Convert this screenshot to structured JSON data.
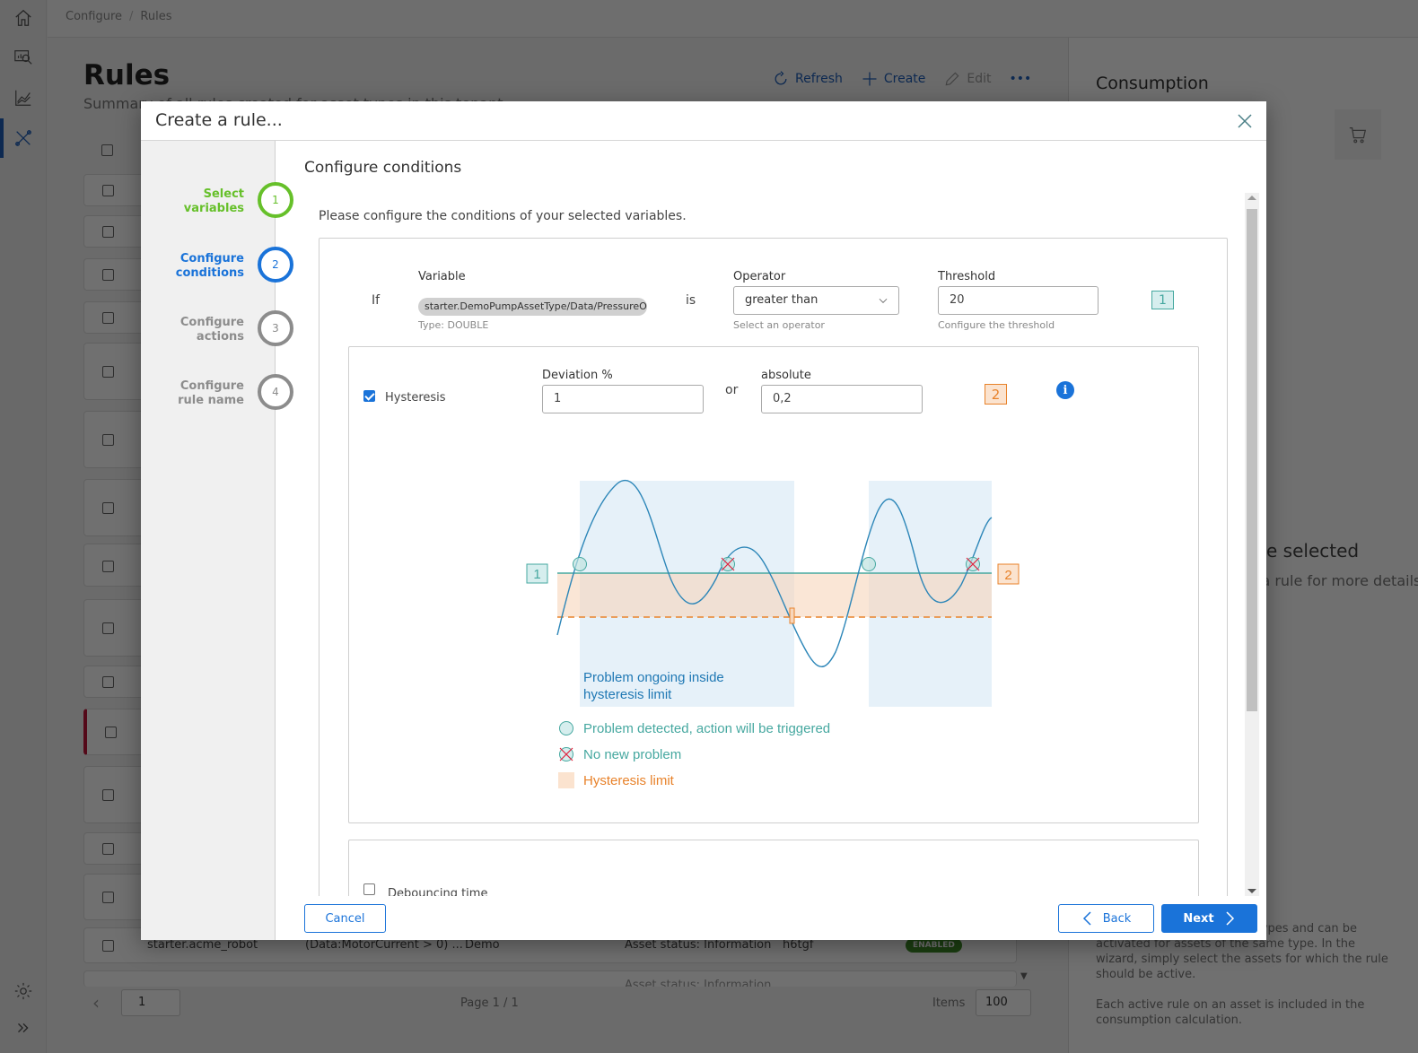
{
  "app": {
    "breadcrumb": [
      "Configure",
      "Rules"
    ],
    "page_title": "Rules",
    "page_subtitle": "Summary of all rules created for asset types in this tenant",
    "toolbar": {
      "refresh_label": "Refresh",
      "create_label": "Create",
      "edit_label": "Edit",
      "more_label": "•••"
    },
    "sidebar_icons": [
      "home-icon",
      "monitor-search-icon",
      "analytics-chart-icon",
      "tools-icon",
      "settings-gear-icon",
      "expand-icon"
    ],
    "consumption": {
      "title": "Consumption",
      "empty_title": "No rule selected",
      "empty_subtitle": "Select a rule for more details",
      "info_paragraph_1": "Rules are created for asset types and can be activated for assets of the same type. In the wizard, simply select the assets for which the rule should be active.",
      "info_paragraph_2": "Each active rule on an asset is included in the consumption calculation."
    },
    "visible_row": {
      "name": "starter.acme_robot",
      "condition": "(Data:MotorCurrent > 0) ...",
      "tenant": "Demo",
      "action": "Asset status: Information",
      "author": "h6tgf",
      "status": "ENABLED"
    },
    "partial_row_text": "Asset status: Information",
    "pager": {
      "page_value": "1",
      "page_info": "Page 1 / 1",
      "items_label": "Items",
      "items_value": "100"
    }
  },
  "modal": {
    "title": "Create a rule...",
    "steps": [
      {
        "number": "1",
        "label_line1": "Select",
        "label_line2": "variables",
        "state": "done"
      },
      {
        "number": "2",
        "label_line1": "Configure",
        "label_line2": "conditions",
        "state": "active"
      },
      {
        "number": "3",
        "label_line1": "Configure",
        "label_line2": "actions",
        "state": "todo"
      },
      {
        "number": "4",
        "label_line1": "Configure",
        "label_line2": "rule name",
        "state": "todo"
      }
    ],
    "section_title": "Configure conditions",
    "intro": "Please configure the conditions of your selected variables.",
    "condition": {
      "if_label": "If",
      "is_label": "is",
      "variable_label": "Variable",
      "variable_value": "starter.DemoPumpAssetType/Data/PressureOut",
      "variable_type": "Type: DOUBLE",
      "operator_label": "Operator",
      "operator_value": "greater than",
      "operator_hint": "Select an operator",
      "threshold_label": "Threshold",
      "threshold_value": "20",
      "threshold_hint": "Configure the threshold",
      "marker": "1"
    },
    "hysteresis": {
      "checked": true,
      "label": "Hysteresis",
      "deviation_label": "Deviation %",
      "deviation_value": "1",
      "or_label": "or",
      "absolute_label": "absolute",
      "absolute_value": "0,2",
      "marker": "2"
    },
    "diagram": {
      "threshold_marker": "1",
      "hysteresis_marker": "2",
      "region_caption_line1": "Problem ongoing inside",
      "region_caption_line2": "hysteresis limit",
      "legend": [
        {
          "icon": "problem-detected-circle-icon",
          "label": "Problem detected, action will be triggered",
          "color": "#46a8a0"
        },
        {
          "icon": "no-new-problem-cross-icon",
          "label": "No new problem",
          "color": "#46a8a0"
        },
        {
          "icon": "hysteresis-limit-swatch-icon",
          "label": "Hysteresis limit",
          "color": "#e8822a"
        }
      ]
    },
    "debouncing": {
      "checked": false,
      "label": "Debouncing time"
    },
    "buttons": {
      "cancel": "Cancel",
      "back": "Back",
      "next": "Next"
    }
  },
  "colors": {
    "accent_blue": "#1a73d9",
    "step_done_green": "#66c02a",
    "teal": "#46a8a0",
    "orange": "#e8822a",
    "alert_red": "#c0153a"
  }
}
